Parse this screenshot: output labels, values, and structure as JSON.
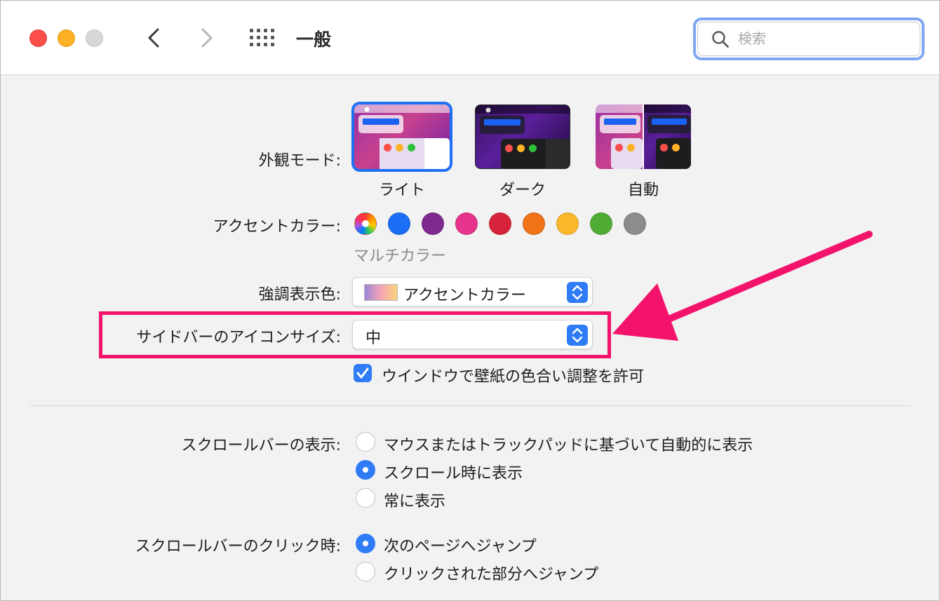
{
  "window": {
    "title": "一般"
  },
  "search": {
    "placeholder": "検索"
  },
  "appearance": {
    "label": "外観モード:",
    "options": [
      {
        "label": "ライト",
        "selected": true
      },
      {
        "label": "ダーク",
        "selected": false
      },
      {
        "label": "自動",
        "selected": false
      }
    ]
  },
  "accent": {
    "label": "アクセントカラー:",
    "selected_name": "マルチカラー",
    "colors": [
      "multicolor",
      "#1b6ef5",
      "#7e2a8f",
      "#e8338c",
      "#d7243a",
      "#f07317",
      "#fbb82a",
      "#4fad35",
      "#8c8c8c"
    ]
  },
  "highlight": {
    "label": "強調表示色:",
    "value": "アクセントカラー"
  },
  "sidebar_icon_size": {
    "label": "サイドバーのアイコンサイズ:",
    "value": "中"
  },
  "wallpaper_tinting": {
    "label": "ウインドウで壁紙の色合い調整を許可",
    "checked": true
  },
  "show_scrollbars": {
    "label": "スクロールバーの表示:",
    "options": [
      {
        "label": "マウスまたはトラックパッドに基づいて自動的に表示",
        "selected": false
      },
      {
        "label": "スクロール時に表示",
        "selected": true
      },
      {
        "label": "常に表示",
        "selected": false
      }
    ]
  },
  "click_scrollbar": {
    "label": "スクロールバーのクリック時:",
    "options": [
      {
        "label": "次のページへジャンプ",
        "selected": true
      },
      {
        "label": "クリックされた部分へジャンプ",
        "selected": false
      }
    ]
  },
  "colors": {
    "accent_blue": "#2f7cf6",
    "annotation_pink": "#f4136c",
    "search_focus": "#7fa7f3"
  }
}
